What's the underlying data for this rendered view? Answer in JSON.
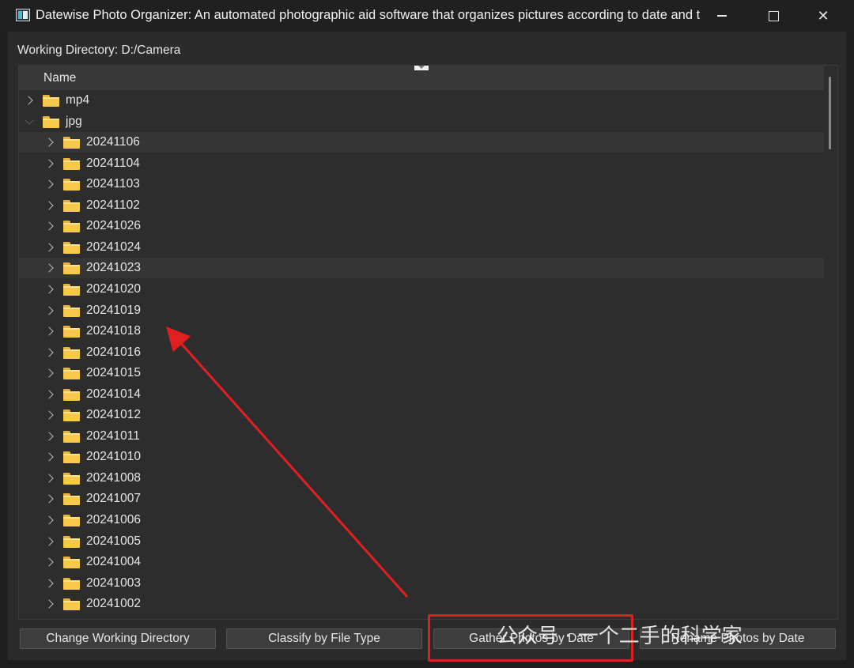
{
  "window": {
    "title": "Datewise Photo Organizer: An automated photographic aid software that organizes pictures according to date and ti..."
  },
  "working_directory": "Working Directory: D:/Camera",
  "tree": {
    "header": "Name",
    "root_items": [
      {
        "label": "mp4",
        "expanded": false
      },
      {
        "label": "jpg",
        "expanded": true
      }
    ],
    "jpg_children": [
      "20241106",
      "20241104",
      "20241103",
      "20241102",
      "20241026",
      "20241024",
      "20241023",
      "20241020",
      "20241019",
      "20241018",
      "20241016",
      "20241015",
      "20241014",
      "20241012",
      "20241011",
      "20241010",
      "20241008",
      "20241007",
      "20241006",
      "20241005",
      "20241004",
      "20241003",
      "20241002"
    ],
    "highlighted_rows": [
      "20241106",
      "20241023"
    ]
  },
  "buttons": {
    "change_dir": "Change Working Directory",
    "classify": "Classify by File Type",
    "gather": "Gather Photos by Date",
    "rename": "Rename Photos by Date"
  },
  "annotation": {
    "watermark": "公众号 · 一个二手的科学家",
    "accent_color": "#e02020"
  }
}
